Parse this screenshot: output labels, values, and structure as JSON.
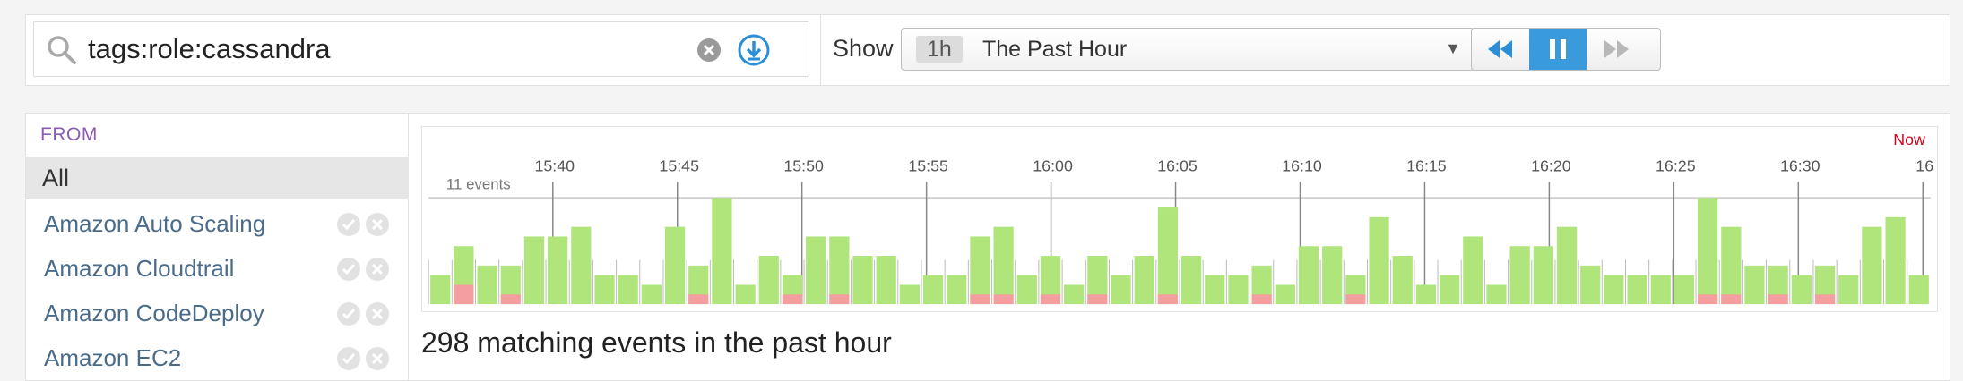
{
  "search": {
    "query": "tags:role:cassandra"
  },
  "timeframe": {
    "show_label": "Show",
    "badge": "1h",
    "text": "The Past Hour"
  },
  "sidebar": {
    "header": "FROM",
    "all_label": "All",
    "items": [
      {
        "label": "Amazon Auto Scaling"
      },
      {
        "label": "Amazon Cloudtrail"
      },
      {
        "label": "Amazon CodeDeploy"
      },
      {
        "label": "Amazon EC2"
      }
    ]
  },
  "chart_data": {
    "type": "bar",
    "count_label": "11 events",
    "now_label": "Now",
    "ticks": [
      "15:40",
      "15:45",
      "15:50",
      "15:55",
      "16:00",
      "16:05",
      "16:10",
      "16:15",
      "16:20",
      "16:25",
      "16:30",
      "16"
    ],
    "ylim": [
      0,
      11
    ],
    "colors": {
      "ok": "#b0e57c",
      "error": "#f59ea0",
      "now": "#d0021b"
    },
    "series": [
      {
        "values_ok": [
          3,
          6,
          4,
          4,
          7,
          7,
          8,
          3,
          3,
          2,
          8,
          4,
          11,
          2,
          5,
          3,
          7,
          7,
          5,
          5,
          2,
          3,
          3,
          7,
          8,
          3,
          5,
          2,
          5,
          3,
          5,
          10,
          5,
          3,
          3,
          4,
          2,
          6,
          6,
          3,
          9,
          5,
          2,
          3,
          7,
          2,
          6,
          6,
          8,
          4,
          3,
          3,
          3,
          3,
          11,
          8,
          4,
          4,
          3,
          4,
          3,
          8,
          9,
          3
        ]
      },
      {
        "values_error": [
          0,
          2,
          0,
          1,
          0,
          0,
          0,
          0,
          0,
          0,
          0,
          1,
          0,
          0,
          0,
          1,
          0,
          1,
          0,
          0,
          0,
          0,
          0,
          1,
          1,
          0,
          1,
          0,
          1,
          0,
          0,
          1,
          0,
          0,
          0,
          1,
          0,
          0,
          0,
          1,
          0,
          0,
          0,
          0,
          0,
          0,
          0,
          0,
          0,
          0,
          0,
          0,
          0,
          0,
          1,
          1,
          0,
          1,
          0,
          1,
          0,
          0,
          0,
          0
        ]
      }
    ]
  },
  "summary": "298 matching events in the past hour"
}
